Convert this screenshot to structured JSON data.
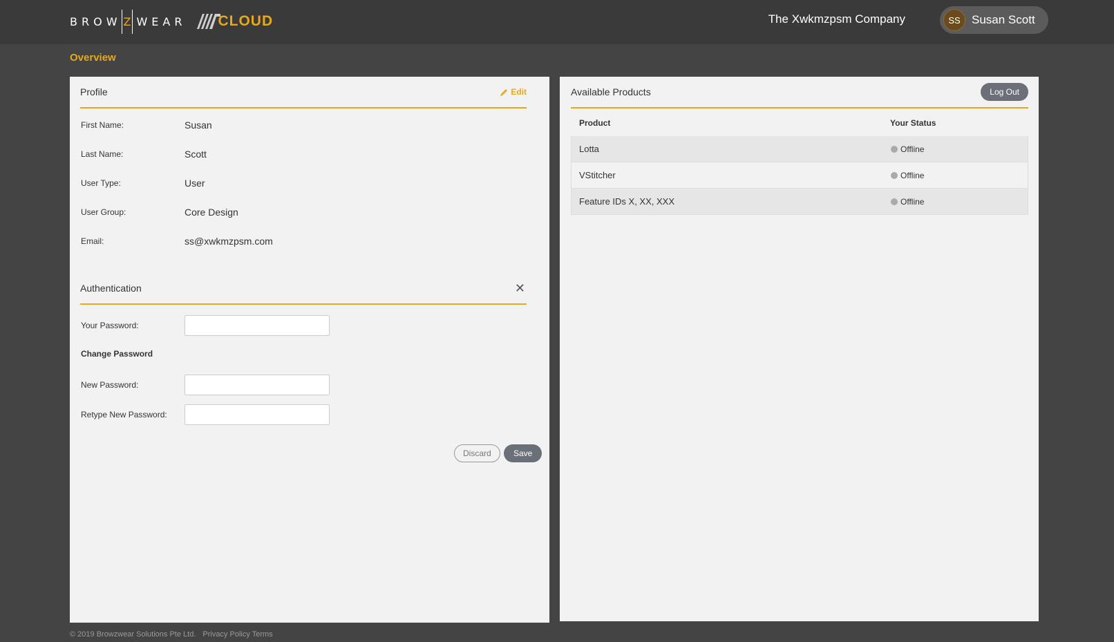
{
  "header": {
    "logo_text": "BROWZWEAR",
    "logo_before_z": "BROW",
    "logo_z": "Z",
    "logo_after_z": "WEAR",
    "cloud_text": "CLOUD",
    "company": "The Xwkmzpsm Company",
    "user_initials": "SS",
    "user_name": "Susan Scott"
  },
  "page": {
    "title": "Overview"
  },
  "profile": {
    "title": "Profile",
    "edit_label": "Edit",
    "edit_icon": "pencil-icon",
    "fields": [
      {
        "label": "First Name:",
        "value": "Susan"
      },
      {
        "label": "Last Name:",
        "value": "Scott"
      },
      {
        "label": "User Type:",
        "value": "User"
      },
      {
        "label": "User Group:",
        "value": "Core Design"
      },
      {
        "label": "Email:",
        "value": "ss@xwkmzpsm.com"
      }
    ]
  },
  "authentication": {
    "title": "Authentication",
    "close_icon": "close-icon",
    "your_password_label": "Your Password:",
    "change_password_heading": "Change Password",
    "new_password_label": "New Password:",
    "retype_password_label": "Retype New Password:",
    "your_password_value": "",
    "new_password_value": "",
    "retype_password_value": "",
    "discard_label": "Discard",
    "save_label": "Save"
  },
  "products": {
    "title": "Available Products",
    "logout_label": "Log Out",
    "columns": [
      "Product",
      "Your Status"
    ],
    "rows": [
      {
        "product": "Lotta",
        "status": "Offline"
      },
      {
        "product": "VStitcher",
        "status": "Offline"
      },
      {
        "product": "Feature IDs X, XX, XXX",
        "status": "Offline"
      }
    ]
  },
  "footer": {
    "copyright": "© 2019 Browzwear Solutions Pte Ltd.",
    "privacy_link": "Privacy Policy",
    "terms_link": "Terms"
  },
  "colors": {
    "accent": "#e8a81c",
    "topbar": "#3a3a3a",
    "background": "#444444",
    "panel": "#f2f2f2",
    "button": "#6b6f78",
    "status_offline": "#aaaaaa"
  }
}
